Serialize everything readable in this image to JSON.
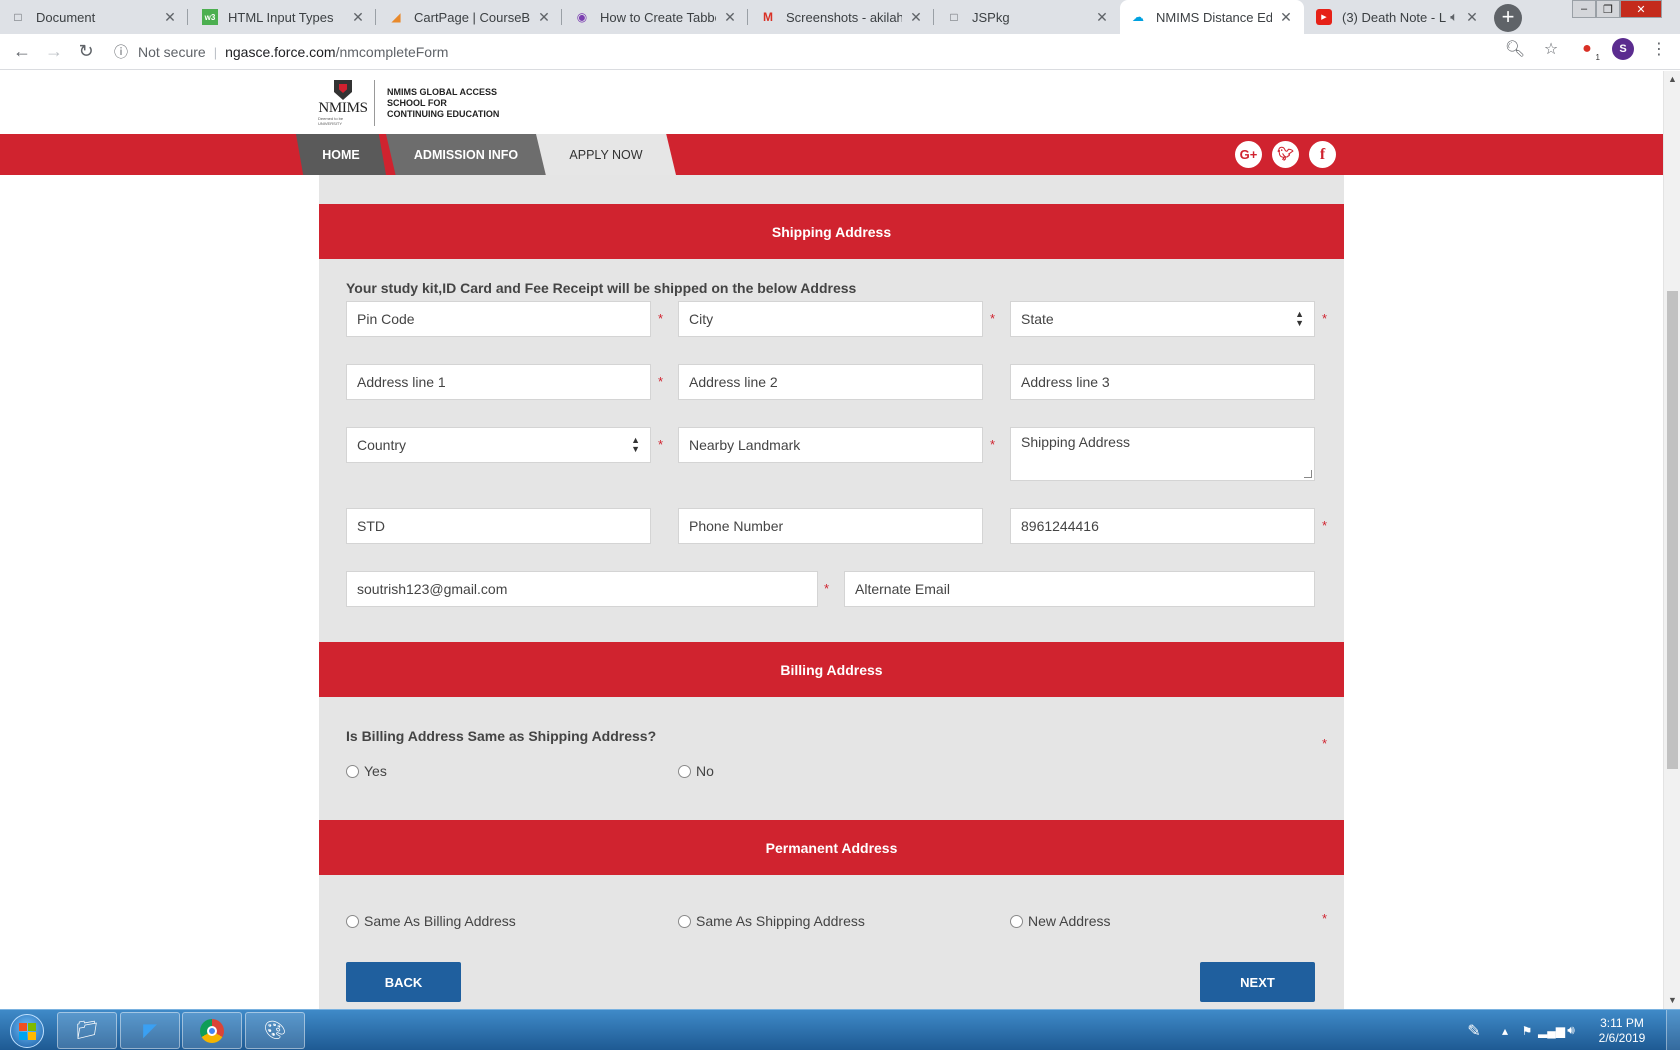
{
  "browser": {
    "tabs": [
      {
        "title": "Document",
        "icon": "doc-icon"
      },
      {
        "title": "HTML Input Types",
        "icon": "w3schools-icon"
      },
      {
        "title": "CartPage | CourseBrot",
        "icon": "cart-icon"
      },
      {
        "title": "How to Create Tabbed",
        "icon": "tabbed-icon"
      },
      {
        "title": "Screenshots - akilahm",
        "icon": "gmail-icon"
      },
      {
        "title": "JSPkg",
        "icon": "doc-icon"
      },
      {
        "title": "NMIMS Distance Educ",
        "icon": "salesforce-icon"
      },
      {
        "title": "(3) Death Note - L",
        "icon": "youtube-icon"
      }
    ],
    "security_label": "Not secure",
    "url_host": "ngasce.force.com",
    "url_path": "/nmcompleteForm",
    "profile_initial": "S",
    "extension_badge": "1"
  },
  "site": {
    "logo_word": "NMIMS",
    "logo_sub": "Deemed to be UNIVERSITY",
    "logo_lines": [
      "NMIMS GLOBAL ACCESS",
      "SCHOOL FOR",
      "CONTINUING EDUCATION"
    ],
    "nav": {
      "home": "HOME",
      "admission": "ADMISSION INFO",
      "apply": "APPLY NOW"
    },
    "social": {
      "google": "G+",
      "twitter": "t",
      "facebook": "f"
    }
  },
  "shipping": {
    "heading": "Shipping Address",
    "note": "Your study kit,ID Card and Fee Receipt will be shipped on the below Address",
    "pin_code": "Pin Code",
    "city": "City",
    "state": "State",
    "address1": "Address line 1",
    "address2": "Address line 2",
    "address3": "Address line 3",
    "country": "Country",
    "landmark": "Nearby Landmark",
    "shipping_address": "Shipping Address",
    "std": "STD",
    "phone": "Phone Number",
    "mobile": "8961244416",
    "email": "soutrish123@gmail.com",
    "alt_email": "Alternate Email",
    "required_mark": "*"
  },
  "billing": {
    "heading": "Billing Address",
    "question": "Is Billing Address Same as Shipping Address?",
    "yes": "Yes",
    "no": "No"
  },
  "permanent": {
    "heading": "Permanent Address",
    "same_billing": "Same As Billing Address",
    "same_shipping": "Same As Shipping Address",
    "new_address": "New Address"
  },
  "buttons": {
    "back": "BACK",
    "next": "NEXT"
  },
  "taskbar": {
    "time": "3:11 PM",
    "date": "2/6/2019"
  },
  "colors": {
    "brand_red": "#d0232f",
    "button_blue": "#1f5f9e",
    "panel_gray": "#e5e5e5"
  }
}
